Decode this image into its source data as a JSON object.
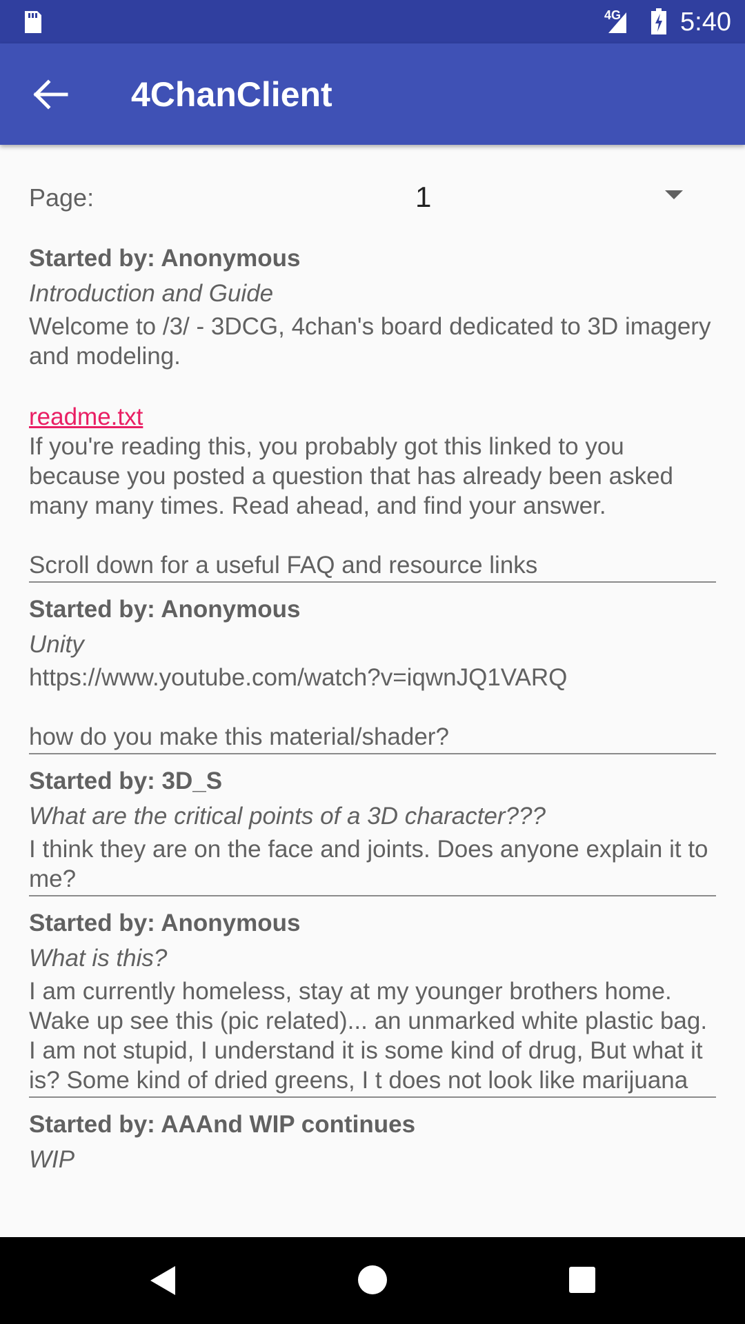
{
  "status_bar": {
    "network": "4G",
    "time": "5:40",
    "icons": [
      "sd-card-icon",
      "signal-icon",
      "battery-charging-icon"
    ]
  },
  "app_bar": {
    "title": "4ChanClient",
    "back_icon": "arrow-back-icon",
    "color": "#3f51b5"
  },
  "page_selector": {
    "label": "Page:",
    "value": "1"
  },
  "threads": [
    {
      "author": "Started by: Anonymous",
      "title": "Introduction and Guide",
      "body1": "Welcome to /3/ - 3DCG, 4chan's board dedicated to 3D imagery and modeling.",
      "link": "readme.txt",
      "body2": "If you're reading this, you probably got this linked to you because you posted a question that has already been asked many many times. Read ahead, and find your answer.\n\nScroll down for a useful FAQ and resource links"
    },
    {
      "author": "Started by: Anonymous",
      "title": "Unity",
      "body": "https://www.youtube.com/watch?v=iqwnJQ1VARQ\n\nhow do you make this material/shader?"
    },
    {
      "author": "Started by: 3D_S",
      "title": "What are the critical points of a 3D character???",
      "body": "I think they are on the face and joints. Does anyone explain it to me?"
    },
    {
      "author": "Started by: Anonymous",
      "title": "What is this?",
      "body": "I am currently homeless, stay at my younger brothers home. Wake up see this (pic related)... an unmarked white plastic bag. I am not stupid, I understand it is some kind of drug, But what it is? Some kind of dried greens, I t does not look like marijuana"
    },
    {
      "author": "Started by: AAAnd WIP continues",
      "title": "WIP"
    }
  ],
  "link_color": "#e91e63",
  "nav_bar": {
    "icons": [
      "nav-back-icon",
      "nav-home-icon",
      "nav-recents-icon"
    ]
  }
}
